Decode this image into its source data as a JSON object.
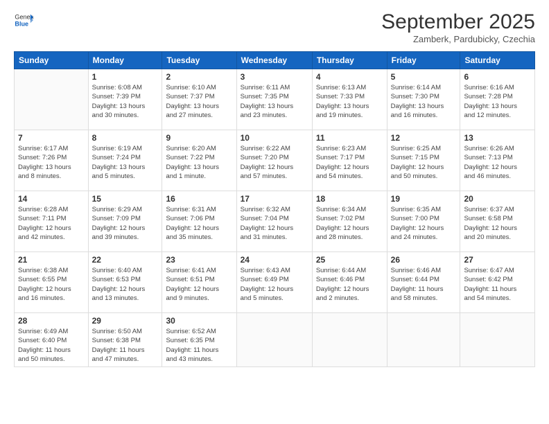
{
  "logo": {
    "general": "General",
    "blue": "Blue"
  },
  "header": {
    "month": "September 2025",
    "location": "Zamberk, Pardubicky, Czechia"
  },
  "weekdays": [
    "Sunday",
    "Monday",
    "Tuesday",
    "Wednesday",
    "Thursday",
    "Friday",
    "Saturday"
  ],
  "weeks": [
    [
      {
        "day": "",
        "info": ""
      },
      {
        "day": "1",
        "info": "Sunrise: 6:08 AM\nSunset: 7:39 PM\nDaylight: 13 hours\nand 30 minutes."
      },
      {
        "day": "2",
        "info": "Sunrise: 6:10 AM\nSunset: 7:37 PM\nDaylight: 13 hours\nand 27 minutes."
      },
      {
        "day": "3",
        "info": "Sunrise: 6:11 AM\nSunset: 7:35 PM\nDaylight: 13 hours\nand 23 minutes."
      },
      {
        "day": "4",
        "info": "Sunrise: 6:13 AM\nSunset: 7:33 PM\nDaylight: 13 hours\nand 19 minutes."
      },
      {
        "day": "5",
        "info": "Sunrise: 6:14 AM\nSunset: 7:30 PM\nDaylight: 13 hours\nand 16 minutes."
      },
      {
        "day": "6",
        "info": "Sunrise: 6:16 AM\nSunset: 7:28 PM\nDaylight: 13 hours\nand 12 minutes."
      }
    ],
    [
      {
        "day": "7",
        "info": "Sunrise: 6:17 AM\nSunset: 7:26 PM\nDaylight: 13 hours\nand 8 minutes."
      },
      {
        "day": "8",
        "info": "Sunrise: 6:19 AM\nSunset: 7:24 PM\nDaylight: 13 hours\nand 5 minutes."
      },
      {
        "day": "9",
        "info": "Sunrise: 6:20 AM\nSunset: 7:22 PM\nDaylight: 13 hours\nand 1 minute."
      },
      {
        "day": "10",
        "info": "Sunrise: 6:22 AM\nSunset: 7:20 PM\nDaylight: 12 hours\nand 57 minutes."
      },
      {
        "day": "11",
        "info": "Sunrise: 6:23 AM\nSunset: 7:17 PM\nDaylight: 12 hours\nand 54 minutes."
      },
      {
        "day": "12",
        "info": "Sunrise: 6:25 AM\nSunset: 7:15 PM\nDaylight: 12 hours\nand 50 minutes."
      },
      {
        "day": "13",
        "info": "Sunrise: 6:26 AM\nSunset: 7:13 PM\nDaylight: 12 hours\nand 46 minutes."
      }
    ],
    [
      {
        "day": "14",
        "info": "Sunrise: 6:28 AM\nSunset: 7:11 PM\nDaylight: 12 hours\nand 42 minutes."
      },
      {
        "day": "15",
        "info": "Sunrise: 6:29 AM\nSunset: 7:09 PM\nDaylight: 12 hours\nand 39 minutes."
      },
      {
        "day": "16",
        "info": "Sunrise: 6:31 AM\nSunset: 7:06 PM\nDaylight: 12 hours\nand 35 minutes."
      },
      {
        "day": "17",
        "info": "Sunrise: 6:32 AM\nSunset: 7:04 PM\nDaylight: 12 hours\nand 31 minutes."
      },
      {
        "day": "18",
        "info": "Sunrise: 6:34 AM\nSunset: 7:02 PM\nDaylight: 12 hours\nand 28 minutes."
      },
      {
        "day": "19",
        "info": "Sunrise: 6:35 AM\nSunset: 7:00 PM\nDaylight: 12 hours\nand 24 minutes."
      },
      {
        "day": "20",
        "info": "Sunrise: 6:37 AM\nSunset: 6:58 PM\nDaylight: 12 hours\nand 20 minutes."
      }
    ],
    [
      {
        "day": "21",
        "info": "Sunrise: 6:38 AM\nSunset: 6:55 PM\nDaylight: 12 hours\nand 16 minutes."
      },
      {
        "day": "22",
        "info": "Sunrise: 6:40 AM\nSunset: 6:53 PM\nDaylight: 12 hours\nand 13 minutes."
      },
      {
        "day": "23",
        "info": "Sunrise: 6:41 AM\nSunset: 6:51 PM\nDaylight: 12 hours\nand 9 minutes."
      },
      {
        "day": "24",
        "info": "Sunrise: 6:43 AM\nSunset: 6:49 PM\nDaylight: 12 hours\nand 5 minutes."
      },
      {
        "day": "25",
        "info": "Sunrise: 6:44 AM\nSunset: 6:46 PM\nDaylight: 12 hours\nand 2 minutes."
      },
      {
        "day": "26",
        "info": "Sunrise: 6:46 AM\nSunset: 6:44 PM\nDaylight: 11 hours\nand 58 minutes."
      },
      {
        "day": "27",
        "info": "Sunrise: 6:47 AM\nSunset: 6:42 PM\nDaylight: 11 hours\nand 54 minutes."
      }
    ],
    [
      {
        "day": "28",
        "info": "Sunrise: 6:49 AM\nSunset: 6:40 PM\nDaylight: 11 hours\nand 50 minutes."
      },
      {
        "day": "29",
        "info": "Sunrise: 6:50 AM\nSunset: 6:38 PM\nDaylight: 11 hours\nand 47 minutes."
      },
      {
        "day": "30",
        "info": "Sunrise: 6:52 AM\nSunset: 6:35 PM\nDaylight: 11 hours\nand 43 minutes."
      },
      {
        "day": "",
        "info": ""
      },
      {
        "day": "",
        "info": ""
      },
      {
        "day": "",
        "info": ""
      },
      {
        "day": "",
        "info": ""
      }
    ]
  ]
}
